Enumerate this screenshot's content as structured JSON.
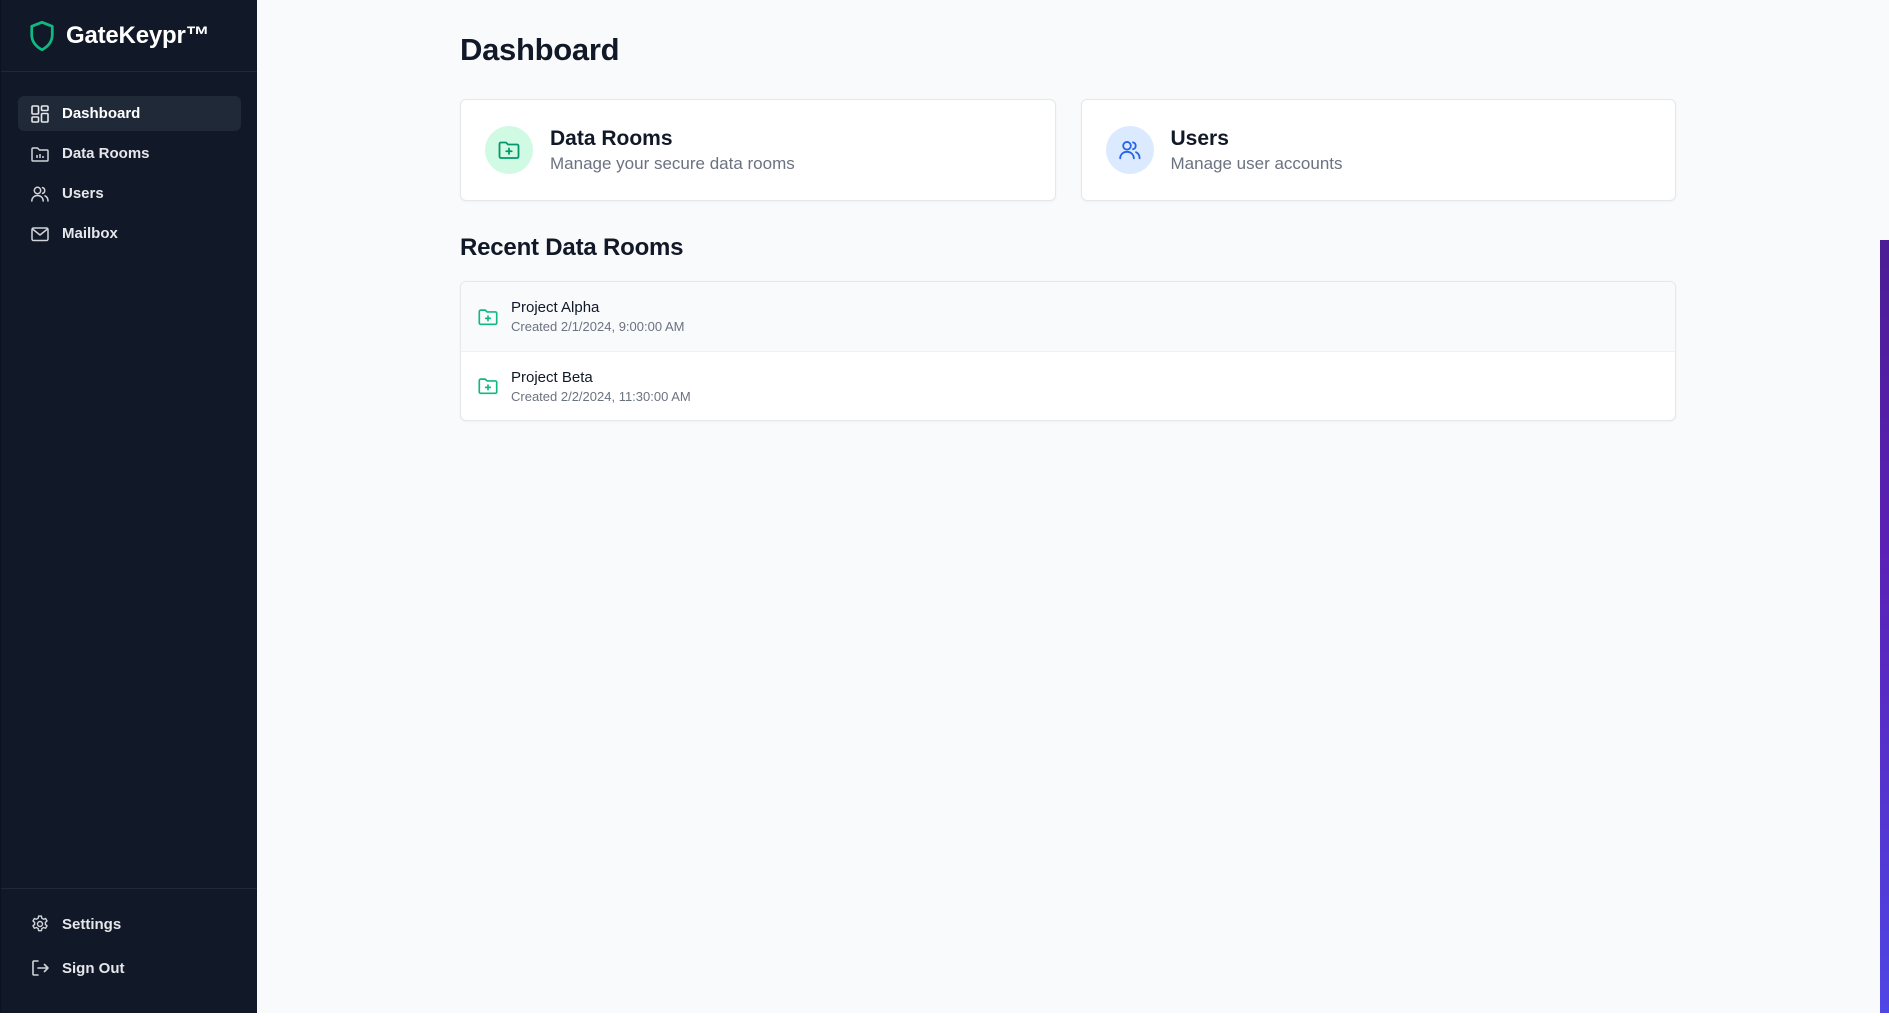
{
  "brand": {
    "name": "GateKeypr™",
    "icon": "shield-icon",
    "accent": "#10b981"
  },
  "sidebar": {
    "items": [
      {
        "label": "Dashboard",
        "icon": "dashboard-icon",
        "active": true
      },
      {
        "label": "Data Rooms",
        "icon": "folder-icon",
        "active": false
      },
      {
        "label": "Users",
        "icon": "users-icon",
        "active": false
      },
      {
        "label": "Mailbox",
        "icon": "mail-icon",
        "active": false
      }
    ],
    "bottom": [
      {
        "label": "Settings",
        "icon": "gear-icon"
      },
      {
        "label": "Sign Out",
        "icon": "sign-out-icon"
      }
    ]
  },
  "main": {
    "title": "Dashboard",
    "cards": [
      {
        "title": "Data Rooms",
        "subtitle": "Manage your secure data rooms",
        "icon": "folder-plus-icon",
        "color": "#10b981"
      },
      {
        "title": "Users",
        "subtitle": "Manage user accounts",
        "icon": "users-icon",
        "color": "#2563eb"
      }
    ],
    "recent": {
      "title": "Recent Data Rooms",
      "rooms": [
        {
          "name": "Project Alpha",
          "created": "Created 2/1/2024, 9:00:00 AM"
        },
        {
          "name": "Project Beta",
          "created": "Created 2/2/2024, 11:30:00 AM"
        }
      ]
    }
  }
}
